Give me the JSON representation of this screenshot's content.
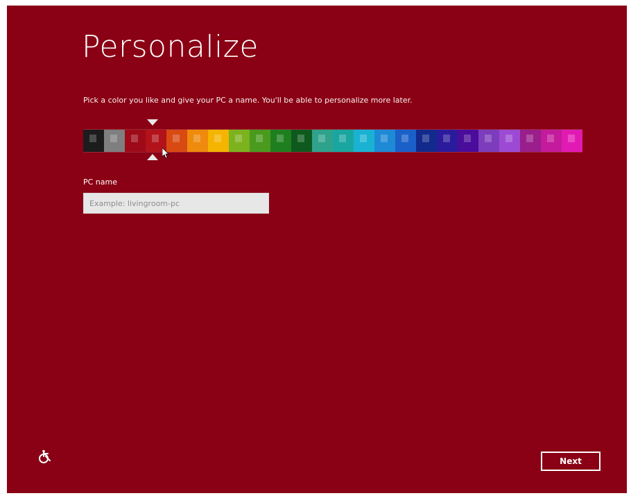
{
  "page": {
    "title": "Personalize",
    "subtitle": "Pick a color you like and give your PC a name. You'll be able to personalize more later."
  },
  "color_picker": {
    "selected_index": 3,
    "swatches": [
      "#1c1c1c",
      "#7f7f7f",
      "#9e0a18",
      "#b2121a",
      "#d84a12",
      "#ef8a0c",
      "#f4b400",
      "#7cb21e",
      "#4a9a1e",
      "#1e7f1e",
      "#0e5a1e",
      "#2fa28c",
      "#1aa6a0",
      "#1ab2d2",
      "#1e8ad6",
      "#1a60c8",
      "#122a8c",
      "#2a1a9c",
      "#4a0c9a",
      "#7c3cbc",
      "#9c4ad4",
      "#9a1e8c",
      "#c41a9c",
      "#e21ab4"
    ]
  },
  "pc_name": {
    "label": "PC name",
    "placeholder": "Example: livingroom-pc",
    "value": ""
  },
  "footer": {
    "next_label": "Next",
    "ease_of_access_icon": "ease-of-access-icon"
  },
  "colors": {
    "background": "#8a0014",
    "text": "#ffffff"
  }
}
